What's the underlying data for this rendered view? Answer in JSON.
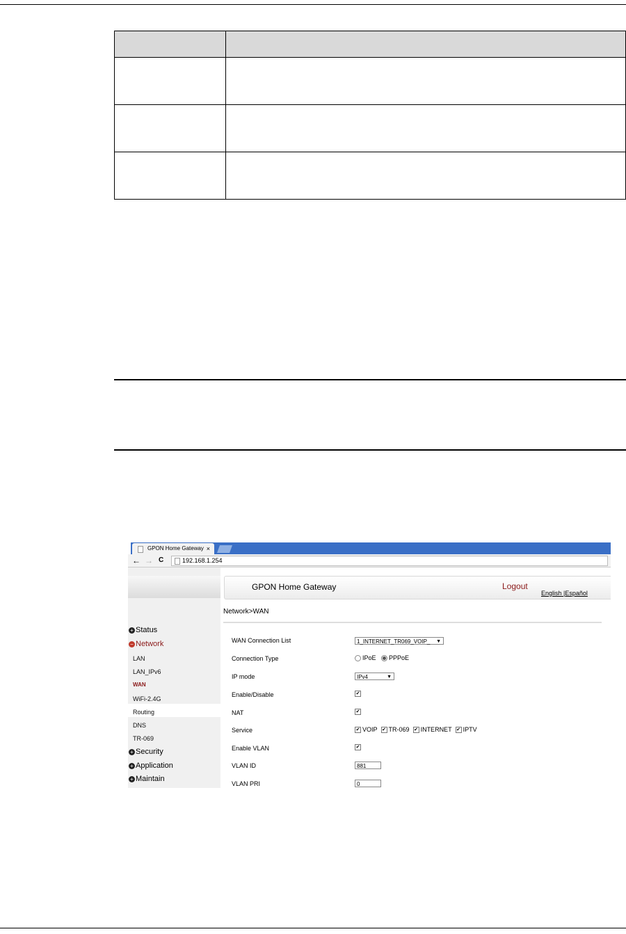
{
  "doc_table": {
    "rows": 4
  },
  "browser": {
    "tab_title": "GPON Home Gateway",
    "tab_close": "×",
    "back": "←",
    "forward": "→",
    "reload": "C",
    "url": "192.168.1.254"
  },
  "header": {
    "title": "GPON Home Gateway",
    "logout": "Logout",
    "lang_english": "English",
    "lang_sep": " |",
    "lang_espanol": "Español"
  },
  "breadcrumb": "Network>WAN",
  "sidebar": {
    "status": "Status",
    "network": "Network",
    "sub": [
      "LAN",
      "LAN_IPv6",
      "WAN",
      "WiFi-2.4G",
      "Routing",
      "DNS",
      "TR-069"
    ],
    "security": "Security",
    "application": "Application",
    "maintain": "Maintain"
  },
  "form": {
    "labels": [
      "WAN Connection List",
      "Connection Type",
      "IP mode",
      "Enable/Disable",
      "NAT",
      "Service",
      "Enable VLAN",
      "VLAN ID",
      "VLAN PRI"
    ],
    "wan_list_value": "1_INTERNET_TR069_VOIP_",
    "conn_type_ipoe": "IPoE",
    "conn_type_pppoe": "PPPoE",
    "ip_mode_value": "IPv4",
    "service_voip": "VOIP",
    "service_tr069": "TR-069",
    "service_internet": "INTERNET",
    "service_iptv": "IPTV",
    "vlan_id": "881",
    "vlan_pri": "0"
  },
  "colors": {
    "tabbar": "#3a6fc6",
    "logout": "#8b1a1a",
    "network_active": "#c0392b",
    "wan_active": "#8b1a1a"
  }
}
